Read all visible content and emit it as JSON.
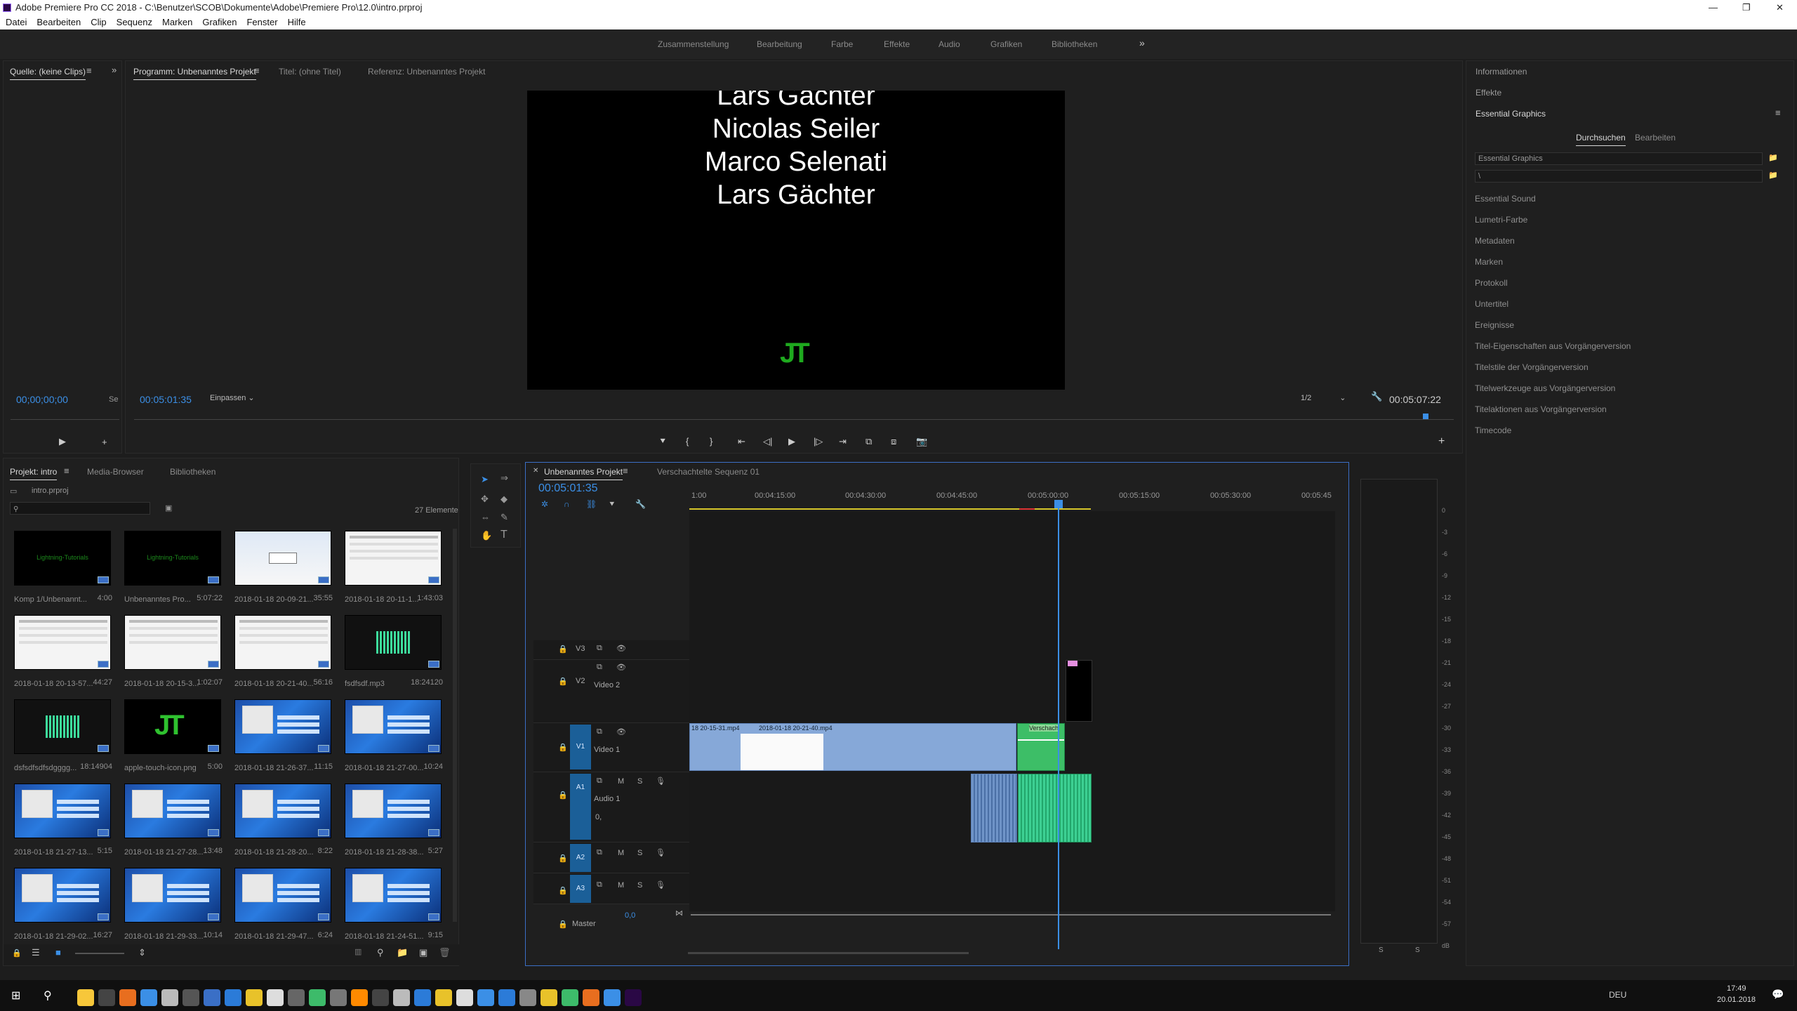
{
  "app": {
    "title": "Adobe Premiere Pro CC 2018 - C:\\Benutzer\\SCOB\\Dokumente\\Adobe\\Premiere Pro\\12.0\\intro.prproj",
    "menu": [
      "Datei",
      "Bearbeiten",
      "Clip",
      "Sequenz",
      "Marken",
      "Grafiken",
      "Fenster",
      "Hilfe"
    ],
    "workspaces": [
      "Zusammenstellung",
      "Bearbeitung",
      "Farbe",
      "Effekte",
      "Audio",
      "Grafiken",
      "Bibliotheken"
    ],
    "workspace_more": "»"
  },
  "source_panel": {
    "tab": "Quelle: (keine Clips)",
    "timecode": "00;00;00;00",
    "se": "Se"
  },
  "program_panel": {
    "tabs": [
      "Programm: Unbenanntes Projekt",
      "Titel: (ohne Titel)",
      "Referenz: Unbenanntes Projekt"
    ],
    "credits": [
      "Lars Gächter",
      "Nicolas Seiler",
      "Marco Selenati",
      "Lars Gächter"
    ],
    "logo_text": "JT",
    "timecode": "00:05:01:35",
    "fit": "Einpassen",
    "resolution": "1/2",
    "duration": "00:05:07:22"
  },
  "right_panel": {
    "info": "Informationen",
    "effects": "Effekte",
    "eg_title": "Essential Graphics",
    "eg_tabs": [
      "Durchsuchen",
      "Bearbeiten"
    ],
    "eg_dropdown": "Essential Graphics",
    "eg_path": "\\",
    "items": [
      "Essential Sound",
      "Lumetri-Farbe",
      "Metadaten",
      "Marken",
      "Protokoll",
      "Untertitel",
      "Ereignisse",
      "Titel-Eigenschaften aus Vorgängerversion",
      "Titelstile der Vorgängerversion",
      "Titelwerkzeuge aus Vorgängerversion",
      "Titelaktionen aus Vorgängerversion",
      "Timecode"
    ]
  },
  "project_panel": {
    "tabs": [
      "Projekt: intro",
      "Media-Browser",
      "Bibliotheken"
    ],
    "file": "intro.prproj",
    "count": "27 Elemente",
    "items": [
      {
        "name": "Komp 1/Unbenannt...",
        "dur": "4:00",
        "kind": "title"
      },
      {
        "name": "Unbenanntes Pro...",
        "dur": "5:07:22",
        "kind": "title"
      },
      {
        "name": "2018-01-18 20-09-21...",
        "dur": "35:55",
        "kind": "dialog"
      },
      {
        "name": "2018-01-18 20-11-1...",
        "dur": "1:43:03",
        "kind": "white"
      },
      {
        "name": "2018-01-18 20-13-57...",
        "dur": "44:27",
        "kind": "white"
      },
      {
        "name": "2018-01-18 20-15-3...",
        "dur": "1:02:07",
        "kind": "white"
      },
      {
        "name": "2018-01-18 20-21-40...",
        "dur": "56:16",
        "kind": "white"
      },
      {
        "name": "fsdfsdf.mp3",
        "dur": "18:24120",
        "kind": "wave"
      },
      {
        "name": "dsfsdfsdfsdgggg...",
        "dur": "18:14904",
        "kind": "wave"
      },
      {
        "name": "apple-touch-icon.png",
        "dur": "5:00",
        "kind": "logo"
      },
      {
        "name": "2018-01-18 21-26-37...",
        "dur": "11:15",
        "kind": "win"
      },
      {
        "name": "2018-01-18 21-27-00...",
        "dur": "10:24",
        "kind": "win"
      },
      {
        "name": "2018-01-18 21-27-13...",
        "dur": "5:15",
        "kind": "win"
      },
      {
        "name": "2018-01-18 21-27-28...",
        "dur": "13:48",
        "kind": "win"
      },
      {
        "name": "2018-01-18 21-28-20...",
        "dur": "8:22",
        "kind": "win"
      },
      {
        "name": "2018-01-18 21-28-38...",
        "dur": "5:27",
        "kind": "win"
      },
      {
        "name": "2018-01-18 21-29-02...",
        "dur": "16:27",
        "kind": "win"
      },
      {
        "name": "2018-01-18 21-29-33...",
        "dur": "10:14",
        "kind": "win"
      },
      {
        "name": "2018-01-18 21-29-47...",
        "dur": "6:24",
        "kind": "win"
      },
      {
        "name": "2018-01-18 21-24-51...",
        "dur": "9:15",
        "kind": "win"
      }
    ],
    "thumb_title_text": "Lightning-Tutorials"
  },
  "timeline": {
    "tabs": [
      "Unbenanntes Projekt",
      "Verschachtelte Sequenz 01"
    ],
    "timecode": "00:05:01:35",
    "ruler": [
      "1:00",
      "00:04:15:00",
      "00:04:30:00",
      "00:04:45:00",
      "00:05:00:00",
      "00:05:15:00",
      "00:05:30:00",
      "00:05:45"
    ],
    "tracks": {
      "v3": "V3",
      "v2": "V2",
      "v2_name": "Video 2",
      "v1": "V1",
      "v1_name": "Video 1",
      "a1": "A1",
      "a1_name": "Audio 1",
      "a1_vol": "0,",
      "a2": "A2",
      "a3": "A3",
      "master": "Master",
      "master_val": "0,0"
    },
    "clips": {
      "c1": "18 20-15-31.mp4",
      "c2": "2018-01-18 20-21-40.mp4",
      "c3": "Verschach"
    },
    "msb": [
      "M",
      "S"
    ]
  },
  "meter": {
    "scale": [
      "0",
      "-3",
      "-6",
      "-9",
      "-12",
      "-15",
      "-18",
      "-21",
      "-24",
      "-27",
      "-30",
      "-33",
      "-36",
      "-39",
      "-42",
      "-45",
      "-48",
      "-51",
      "-54",
      "-57",
      "dB"
    ],
    "solo": [
      "S",
      "S"
    ]
  },
  "taskbar": {
    "lang": "DEU",
    "time": "17:49",
    "date": "20.01.2018"
  }
}
